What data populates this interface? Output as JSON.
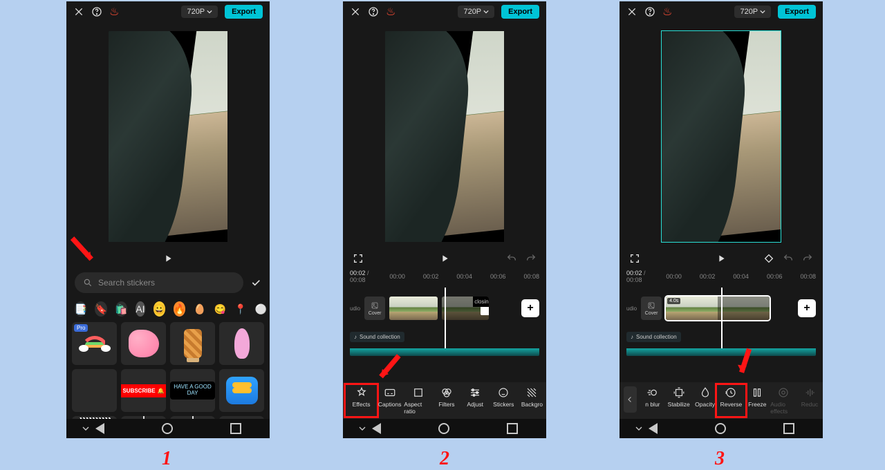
{
  "header": {
    "resolution": "720P",
    "export": "Export"
  },
  "panel1": {
    "search_placeholder": "Search stickers",
    "pro_badge": "Pro",
    "subscribe": "SUBSCRIBE",
    "good_day": "HAVE A GOOD DAY"
  },
  "timeline": {
    "current": "00:02",
    "total": "00:08",
    "marks": [
      "00:00",
      "00:02",
      "00:04",
      "00:06",
      "00:08"
    ],
    "cover": "Cover",
    "closing": "closing",
    "sound": "Sound collection",
    "clip_dur": "4.0s"
  },
  "tools2": {
    "effects": "Effects",
    "captions": "Captions",
    "aspect": "Aspect ratio",
    "filters": "Filters",
    "adjust": "Adjust",
    "stickers": "Stickers",
    "background": "Backgro"
  },
  "tools3": {
    "blur": "n blur",
    "stabilize": "Stabilize",
    "opacity": "Opacity",
    "reverse": "Reverse",
    "freeze": "Freeze",
    "audio": "Audio effects",
    "reduce": "Reduc"
  },
  "steps": {
    "s1": "1",
    "s2": "2",
    "s3": "3"
  },
  "audio_label": "udio"
}
